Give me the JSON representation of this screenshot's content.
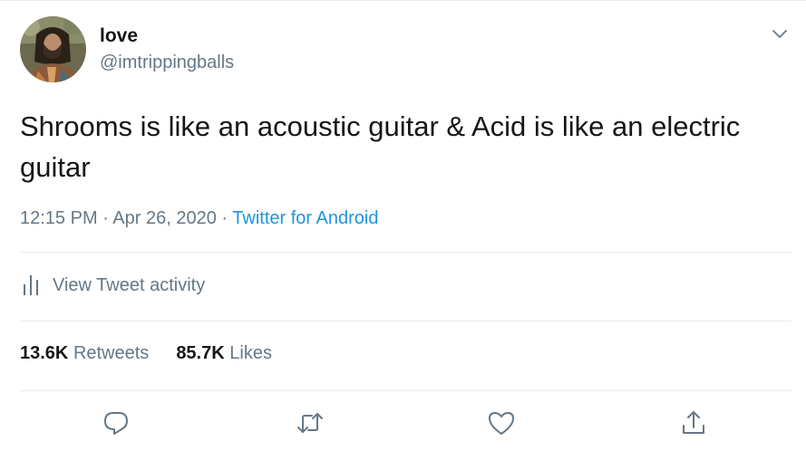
{
  "user": {
    "display_name": "love",
    "handle": "@imtrippingballs"
  },
  "tweet": {
    "text": "Shrooms is like an acoustic guitar & Acid is like an electric guitar",
    "time": "12:15 PM",
    "separator": "·",
    "date": "Apr 26, 2020",
    "source": "Twitter for Android"
  },
  "activity": {
    "label": "View Tweet activity",
    "icon": "bar-chart-icon"
  },
  "stats": {
    "retweets_count": "13.6K",
    "retweets_label": "Retweets",
    "likes_count": "85.7K",
    "likes_label": "Likes"
  },
  "actions": {
    "reply_icon": "reply-icon",
    "retweet_icon": "retweet-icon",
    "like_icon": "heart-icon",
    "share_icon": "share-icon"
  },
  "colors": {
    "text": "#14171a",
    "secondary": "#657786",
    "link": "#1b95e0",
    "divider": "#e6ecf0"
  }
}
